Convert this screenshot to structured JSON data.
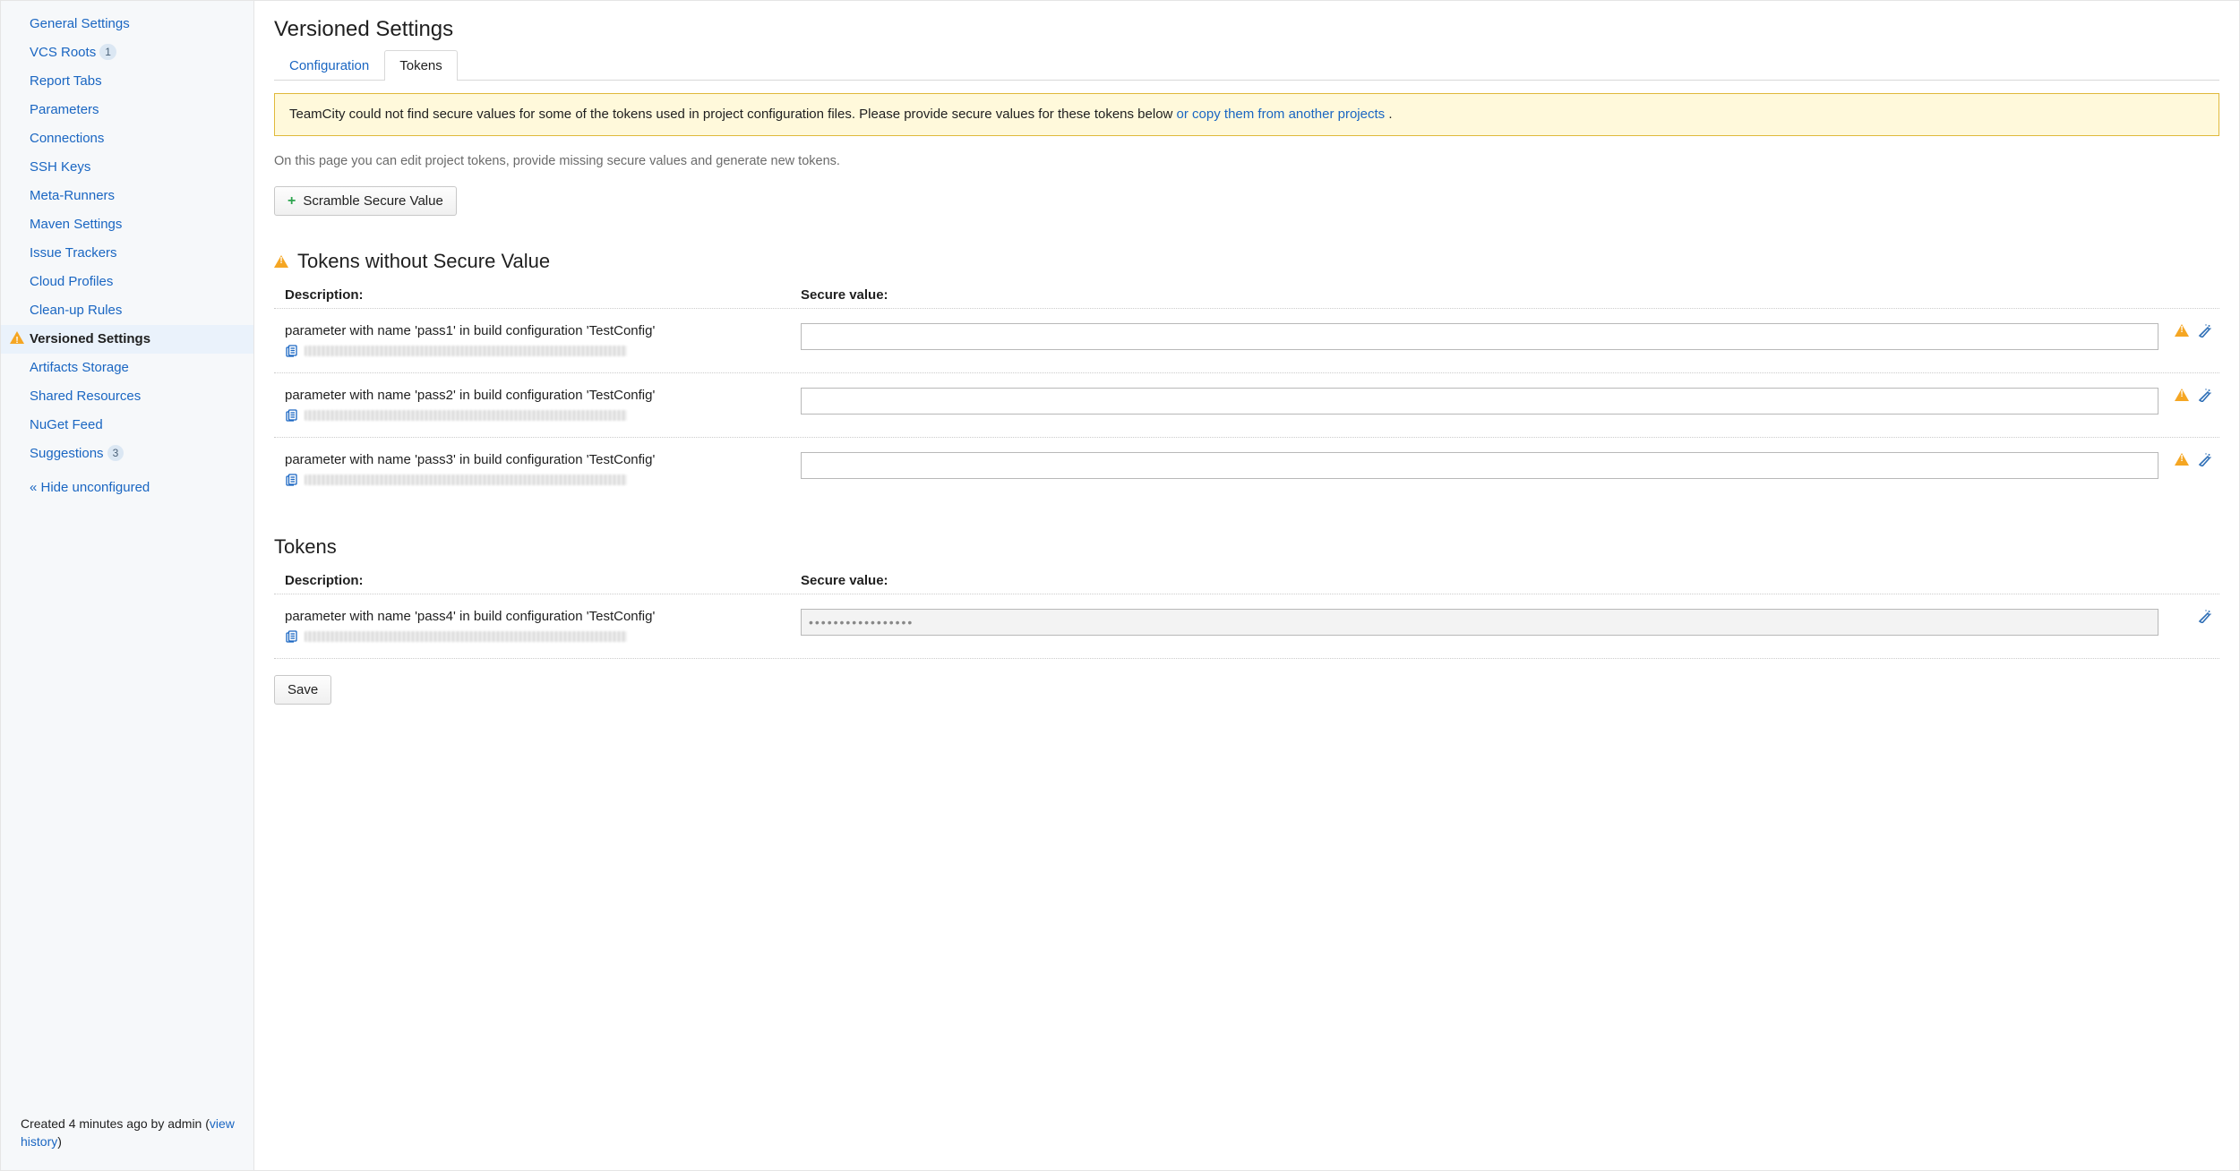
{
  "sidebar": {
    "items": [
      {
        "label": "General Settings",
        "badge": null,
        "active": false,
        "warn": false
      },
      {
        "label": "VCS Roots",
        "badge": "1",
        "active": false,
        "warn": false
      },
      {
        "label": "Report Tabs",
        "badge": null,
        "active": false,
        "warn": false
      },
      {
        "label": "Parameters",
        "badge": null,
        "active": false,
        "warn": false
      },
      {
        "label": "Connections",
        "badge": null,
        "active": false,
        "warn": false
      },
      {
        "label": "SSH Keys",
        "badge": null,
        "active": false,
        "warn": false
      },
      {
        "label": "Meta-Runners",
        "badge": null,
        "active": false,
        "warn": false
      },
      {
        "label": "Maven Settings",
        "badge": null,
        "active": false,
        "warn": false
      },
      {
        "label": "Issue Trackers",
        "badge": null,
        "active": false,
        "warn": false
      },
      {
        "label": "Cloud Profiles",
        "badge": null,
        "active": false,
        "warn": false
      },
      {
        "label": "Clean-up Rules",
        "badge": null,
        "active": false,
        "warn": false
      },
      {
        "label": "Versioned Settings",
        "badge": null,
        "active": true,
        "warn": true
      },
      {
        "label": "Artifacts Storage",
        "badge": null,
        "active": false,
        "warn": false
      },
      {
        "label": "Shared Resources",
        "badge": null,
        "active": false,
        "warn": false
      },
      {
        "label": "NuGet Feed",
        "badge": null,
        "active": false,
        "warn": false
      },
      {
        "label": "Suggestions",
        "badge": "3",
        "active": false,
        "warn": false
      }
    ],
    "hide_label": "« Hide unconfigured",
    "footer_prefix": "Created 4 minutes ago by admin (",
    "footer_link": "view history",
    "footer_suffix": ")"
  },
  "page": {
    "title": "Versioned Settings",
    "tabs": [
      {
        "label": "Configuration",
        "active": false
      },
      {
        "label": "Tokens",
        "active": true
      }
    ],
    "warning_text": "TeamCity could not find secure values for some of the tokens used in project configuration files. Please provide secure values for these tokens below ",
    "warning_link": "or copy them from another projects",
    "warning_link_suffix": " .",
    "helper": "On this page you can edit project tokens, provide missing secure values and generate new tokens.",
    "scramble_label": "Scramble Secure Value",
    "section_missing_title": "Tokens without Secure Value",
    "section_tokens_title": "Tokens",
    "col_desc": "Description:",
    "col_value": "Secure value:",
    "missing_tokens": [
      {
        "desc": "parameter with name 'pass1' in build configuration 'TestConfig'",
        "value": ""
      },
      {
        "desc": "parameter with name 'pass2' in build configuration 'TestConfig'",
        "value": ""
      },
      {
        "desc": "parameter with name 'pass3' in build configuration 'TestConfig'",
        "value": ""
      }
    ],
    "tokens": [
      {
        "desc": "parameter with name 'pass4' in build configuration 'TestConfig'",
        "value": "•••••••••••••••••"
      }
    ],
    "save_label": "Save"
  }
}
